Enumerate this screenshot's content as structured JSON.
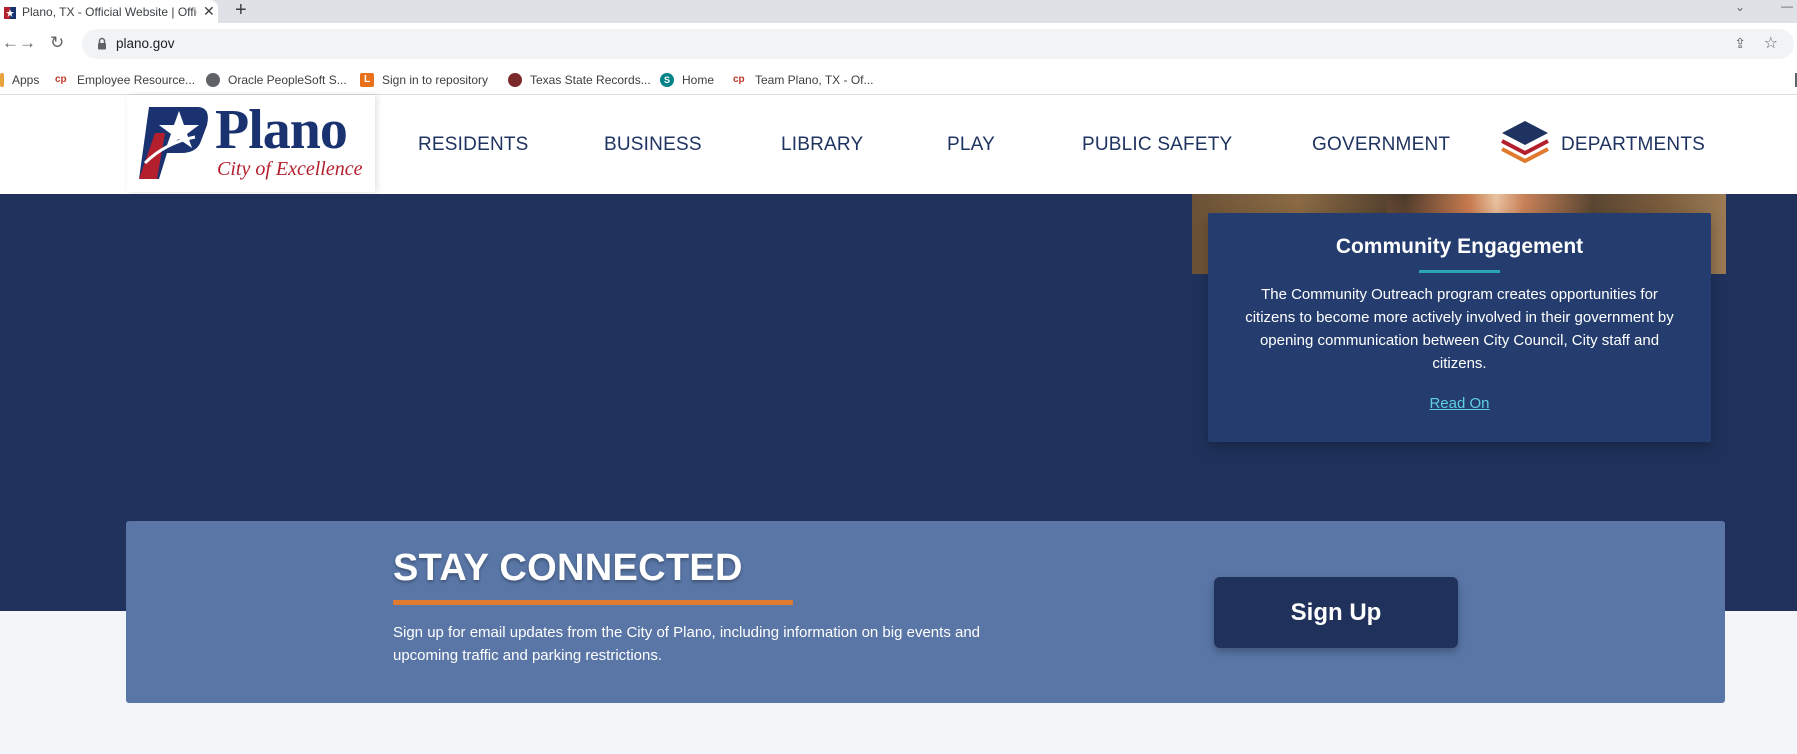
{
  "browser": {
    "tab_title": "Plano, TX - Official Website | Official",
    "new_tab_symbol": "+",
    "close_symbol": "✕",
    "url": "plano.gov",
    "bookmarks": [
      {
        "label": "Apps",
        "icon": "apps-grid-icon",
        "color": "#e8a33d"
      },
      {
        "label": "Employee Resource...",
        "icon": "cp-logo-icon",
        "color": "#c0392b"
      },
      {
        "label": "Oracle PeopleSoft S...",
        "icon": "globe-icon",
        "color": "#5f6368"
      },
      {
        "label": "Sign in to repository",
        "icon": "l-badge-icon",
        "color": "#e8711a"
      },
      {
        "label": "Texas State Records...",
        "icon": "texas-seal-icon",
        "color": "#7a2a2a"
      },
      {
        "label": "Home",
        "icon": "sharepoint-icon",
        "color": "#038387"
      },
      {
        "label": "Team Plano, TX - Of...",
        "icon": "cp-logo-icon",
        "color": "#c0392b"
      }
    ]
  },
  "site": {
    "logo": {
      "word": "Plano",
      "tagline": "City of Excellence",
      "brand_blue": "#1a3370",
      "brand_red": "#b41f2e"
    },
    "nav": [
      {
        "label": "RESIDENTS"
      },
      {
        "label": "BUSINESS"
      },
      {
        "label": "LIBRARY"
      },
      {
        "label": "PLAY"
      },
      {
        "label": "PUBLIC SAFETY"
      },
      {
        "label": "GOVERNMENT"
      },
      {
        "label": "DEPARTMENTS",
        "icon": "layers-icon"
      }
    ],
    "card": {
      "title": "Community Engagement",
      "body": "The Community Outreach program creates opportunities for citizens to become more actively involved in their government by opening communication between City Council, City staff and citizens.",
      "link": "Read On"
    },
    "stay_connected": {
      "title": "STAY CONNECTED",
      "text": "Sign up for email updates from the City of Plano, including information on big events and upcoming traffic and parking restrictions.",
      "button": "Sign Up"
    },
    "colors": {
      "navy": "#20325c",
      "card": "#243d6e",
      "stay_bg": "#5976a6",
      "accent_orange": "#e07a2f",
      "accent_teal": "#2aa7b2"
    }
  }
}
